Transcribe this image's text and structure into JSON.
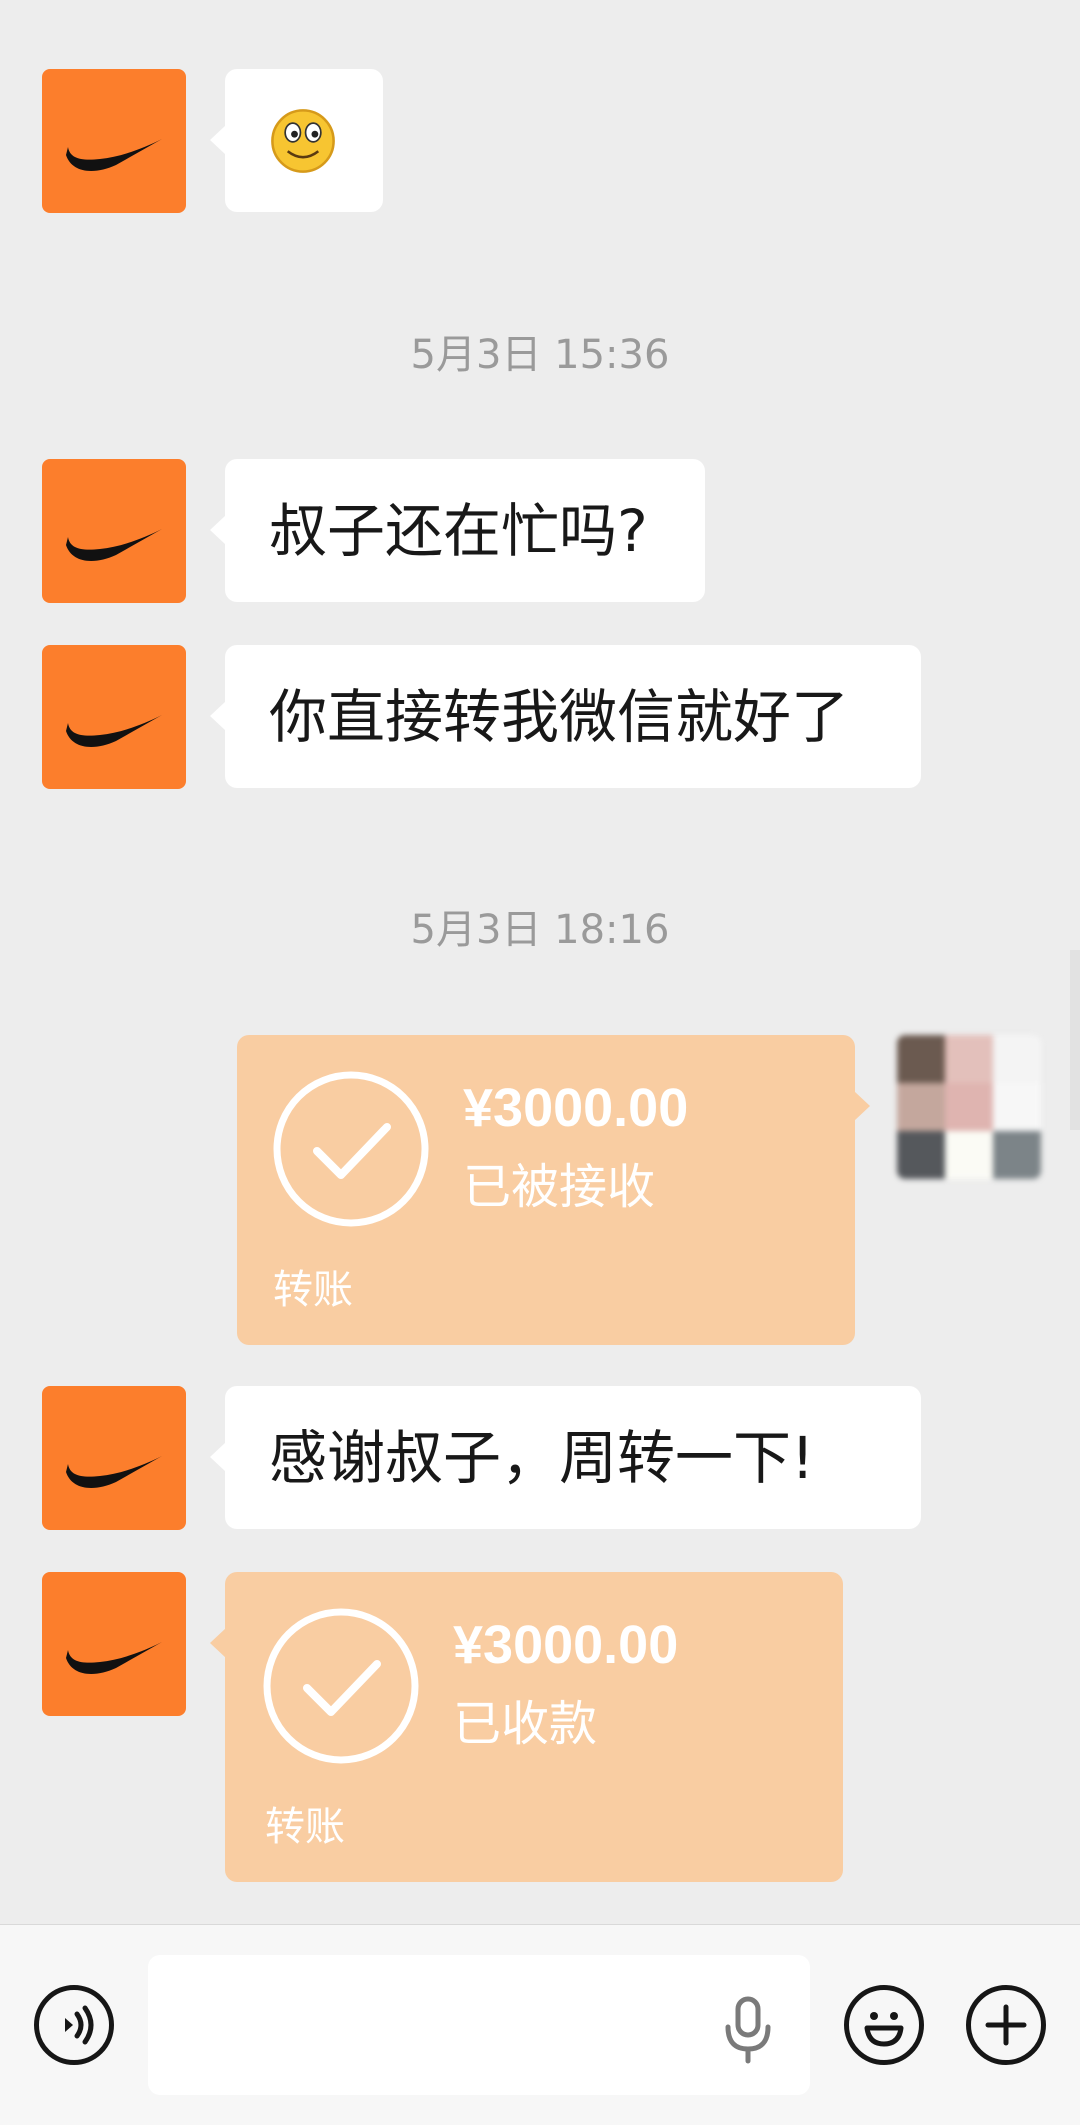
{
  "messages": [
    {
      "sender": "nike",
      "type": "emoji",
      "emoji_name": "smiley-face-icon"
    },
    {
      "type": "timestamp",
      "text": "5月3日 15:36"
    },
    {
      "sender": "nike",
      "type": "text",
      "text": "叔子还在忙吗?"
    },
    {
      "sender": "nike",
      "type": "text",
      "text": "你直接转我微信就好了"
    },
    {
      "type": "timestamp",
      "text": "5月3日 18:16"
    },
    {
      "sender": "me",
      "type": "transfer",
      "amount": "¥3000.00",
      "status": "已被接收",
      "label": "转账"
    },
    {
      "sender": "nike",
      "type": "text",
      "text": "感谢叔子，周转一下!"
    },
    {
      "sender": "nike",
      "type": "transfer",
      "amount": "¥3000.00",
      "status": "已收款",
      "label": "转账"
    }
  ],
  "colors": {
    "avatar_orange": "#fc7e2c",
    "transfer_bg": "#f9cda2",
    "chat_bg": "#ededed",
    "bubble_bg": "#ffffff"
  },
  "input": {
    "value": "",
    "placeholder": ""
  },
  "bottom_bar": {
    "voice_icon": "voice-icon",
    "mic_icon": "microphone-icon",
    "emoji_icon": "emoji-icon",
    "plus_icon": "plus-icon"
  }
}
